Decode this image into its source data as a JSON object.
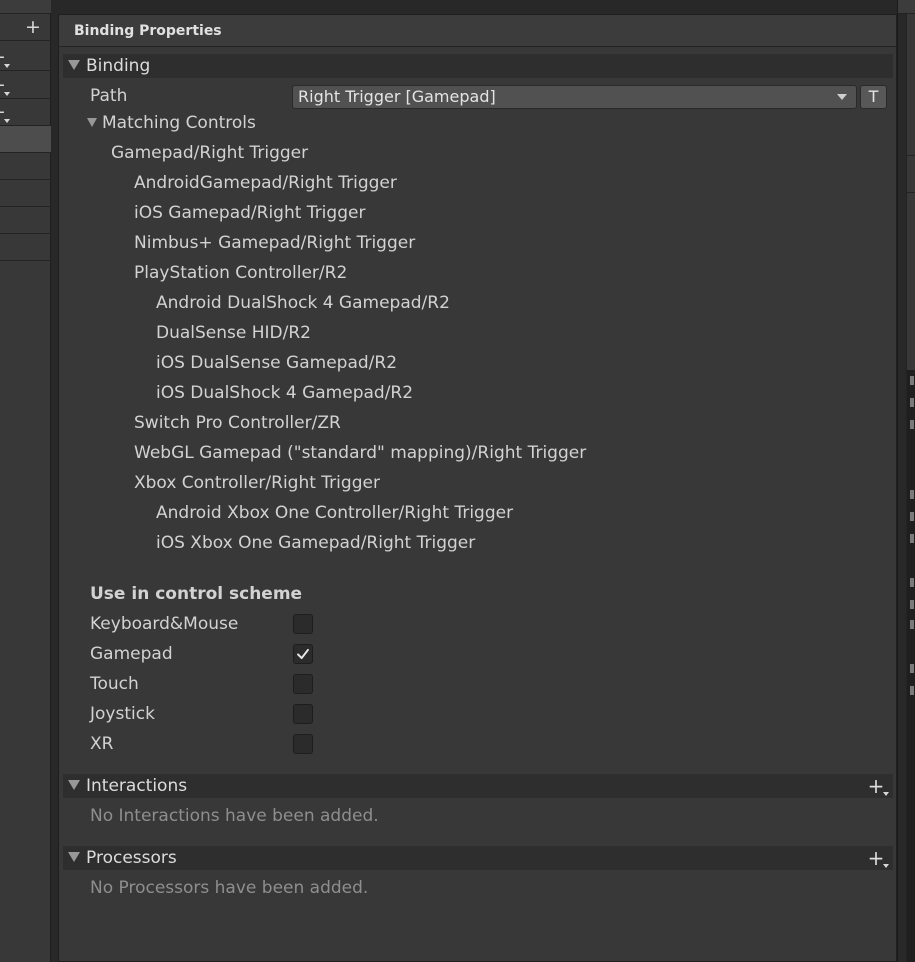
{
  "window": {
    "panel_title": "Binding Properties"
  },
  "binding": {
    "section_label": "Binding",
    "path_label": "Path",
    "path_value": "Right Trigger [Gamepad]",
    "path_mode_button": "T",
    "matching_controls_label": "Matching Controls",
    "matching_controls": [
      {
        "text": "Gamepad/Right Trigger",
        "level": 0
      },
      {
        "text": "AndroidGamepad/Right Trigger",
        "level": 1
      },
      {
        "text": "iOS Gamepad/Right Trigger",
        "level": 1
      },
      {
        "text": "Nimbus+ Gamepad/Right Trigger",
        "level": 1
      },
      {
        "text": "PlayStation Controller/R2",
        "level": 1
      },
      {
        "text": "Android DualShock 4 Gamepad/R2",
        "level": 2
      },
      {
        "text": "DualSense HID/R2",
        "level": 2
      },
      {
        "text": "iOS DualSense Gamepad/R2",
        "level": 2
      },
      {
        "text": "iOS DualShock 4 Gamepad/R2",
        "level": 2
      },
      {
        "text": "Switch Pro Controller/ZR",
        "level": 1
      },
      {
        "text": "WebGL Gamepad (\"standard\" mapping)/Right Trigger",
        "level": 1
      },
      {
        "text": "Xbox Controller/Right Trigger",
        "level": 1
      },
      {
        "text": "Android Xbox One Controller/Right Trigger",
        "level": 2
      },
      {
        "text": "iOS Xbox One Gamepad/Right Trigger",
        "level": 2
      }
    ]
  },
  "control_schemes": {
    "heading": "Use in control scheme",
    "items": [
      {
        "label": "Keyboard&Mouse",
        "checked": false
      },
      {
        "label": "Gamepad",
        "checked": true
      },
      {
        "label": "Touch",
        "checked": false
      },
      {
        "label": "Joystick",
        "checked": false
      },
      {
        "label": "XR",
        "checked": false
      }
    ]
  },
  "interactions": {
    "section_label": "Interactions",
    "empty_text": "No Interactions have been added."
  },
  "processors": {
    "section_label": "Processors",
    "empty_text": "No Processors have been added."
  },
  "icons": {
    "add": "plus-icon",
    "add_dropdown": "plus-dropdown-icon",
    "foldout": "triangle-down-icon",
    "dropdown": "chevron-down-icon",
    "check": "checkmark-icon"
  },
  "colors": {
    "background": "#383838",
    "section_header": "#2e2e2e",
    "field": "#515151",
    "text": "#d2d2d2",
    "muted_text": "#8e8e8e"
  }
}
